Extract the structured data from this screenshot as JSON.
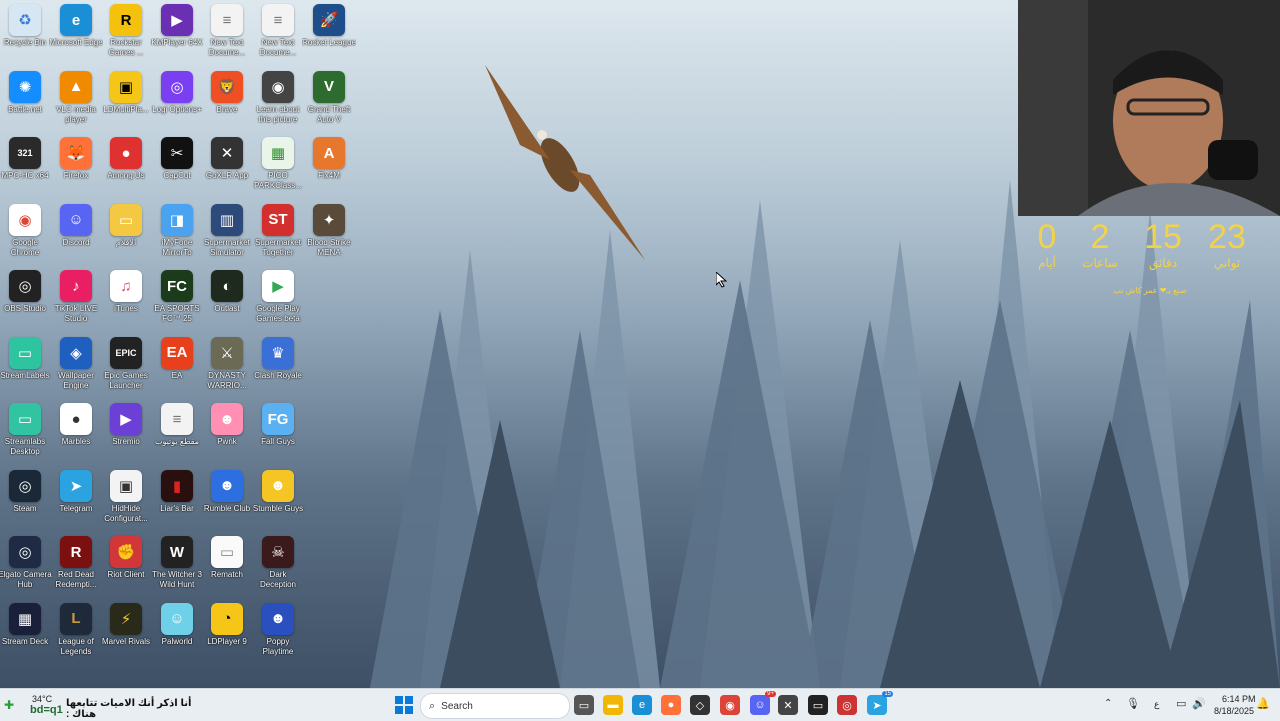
{
  "desktop_icons": [
    {
      "label": "Recycle Bin",
      "color": "#d7e6f3",
      "glyph": "♻",
      "glyph_color": "#3a7bd5"
    },
    {
      "label": "Microsoft Edge",
      "color": "#1b8fd6",
      "glyph": "e"
    },
    {
      "label": "Rockstar Games ...",
      "color": "#f4c20d",
      "glyph": "R",
      "glyph_color": "#000"
    },
    {
      "label": "KMPlayer 64X",
      "color": "#6b2fb3",
      "glyph": "▶"
    },
    {
      "label": "New Text Docume...",
      "color": "#f3f3f3",
      "glyph": "≡",
      "glyph_color": "#777"
    },
    {
      "label": "New Text Docume...",
      "color": "#f3f3f3",
      "glyph": "≡",
      "glyph_color": "#777"
    },
    {
      "label": "Rocket League",
      "color": "#1d4e89",
      "glyph": "🚀"
    },
    {
      "label": "Battle.net",
      "color": "#148eff",
      "glyph": "✺"
    },
    {
      "label": "VLC media player",
      "color": "#f08a00",
      "glyph": "▲"
    },
    {
      "label": "LDMultiPla...",
      "color": "#f5c518",
      "glyph": "▣",
      "glyph_color": "#000"
    },
    {
      "label": "Logi Options+",
      "color": "#7b3ff2",
      "glyph": "◎"
    },
    {
      "label": "Brave",
      "color": "#f04e23",
      "glyph": "🦁"
    },
    {
      "label": "Learn about this picture",
      "color": "#444",
      "glyph": "◉"
    },
    {
      "label": "Grand Theft Auto V",
      "color": "#2e6b2e",
      "glyph": "V"
    },
    {
      "label": "MPC-HC x64",
      "color": "#2a2a2a",
      "glyph": "321"
    },
    {
      "label": "Firefox",
      "color": "#ff7139",
      "glyph": "🦊"
    },
    {
      "label": "Among Us",
      "color": "#e03131",
      "glyph": "●"
    },
    {
      "label": "CapCut",
      "color": "#111",
      "glyph": "✂"
    },
    {
      "label": "GoXLR App",
      "color": "#333",
      "glyph": "✕"
    },
    {
      "label": "PICO PARKClass...",
      "color": "#e8f5e8",
      "glyph": "▦",
      "glyph_color": "#2f8f2f"
    },
    {
      "label": "Fix4M",
      "color": "#e8772e",
      "glyph": "A"
    },
    {
      "label": "Google Chrome",
      "color": "#fff",
      "glyph": "◉",
      "glyph_color": "#db4437"
    },
    {
      "label": "Discord",
      "color": "#5865f2",
      "glyph": "☺"
    },
    {
      "label": "الافلام",
      "color": "#f5c842",
      "glyph": "▭"
    },
    {
      "label": "iMyFone MirrorTo",
      "color": "#4aa3f0",
      "glyph": "◨"
    },
    {
      "label": "Supermarket Simulator",
      "color": "#2c4a7a",
      "glyph": "▥"
    },
    {
      "label": "Supermarket Together",
      "color": "#d32f2f",
      "glyph": "ST"
    },
    {
      "label": "Blood Strike MENA",
      "color": "#5a4a3a",
      "glyph": "✦"
    },
    {
      "label": "OBS Studio",
      "color": "#222",
      "glyph": "◎"
    },
    {
      "label": "TikTok LIVE Studio",
      "color": "#e91e63",
      "glyph": "♪"
    },
    {
      "label": "iTunes",
      "color": "#fff",
      "glyph": "♫",
      "glyph_color": "#e0457b"
    },
    {
      "label": "EA SPORTS FC™ 25",
      "color": "#1b3b1b",
      "glyph": "FC"
    },
    {
      "label": "Outlast",
      "color": "#1f2a1f",
      "glyph": "◐"
    },
    {
      "label": "Google Play Games beta",
      "color": "#fff",
      "glyph": "▶",
      "glyph_color": "#34a853"
    },
    {
      "label": "StreamLabels",
      "color": "#2ec4a0",
      "glyph": "▭"
    },
    {
      "label": "Wallpaper Engine",
      "color": "#1e5fbf",
      "glyph": "◈"
    },
    {
      "label": "Epic Games Launcher",
      "color": "#222",
      "glyph": "EPIC"
    },
    {
      "label": "EA",
      "color": "#e8401c",
      "glyph": "EA"
    },
    {
      "label": "DYNASTY WARRIO...",
      "color": "#6a6a55",
      "glyph": "⚔"
    },
    {
      "label": "Clash Royale",
      "color": "#3a6fd6",
      "glyph": "♛"
    },
    {
      "label": "Streamlabs Desktop",
      "color": "#31c3a2",
      "glyph": "▭"
    },
    {
      "label": "Marbles",
      "color": "#fff",
      "glyph": "●",
      "glyph_color": "#333"
    },
    {
      "label": "Stremio",
      "color": "#6c3fd6",
      "glyph": "▶"
    },
    {
      "label": "مقطع يوتيوب",
      "color": "#f3f3f3",
      "glyph": "≡",
      "glyph_color": "#777"
    },
    {
      "label": "Pwnk",
      "color": "#ff8fb3",
      "glyph": "☻"
    },
    {
      "label": "Fall Guys",
      "color": "#5ab0f0",
      "glyph": "FG"
    },
    {
      "label": "Steam",
      "color": "#1b2838",
      "glyph": "◎"
    },
    {
      "label": "Telegram",
      "color": "#2aa3e0",
      "glyph": "➤"
    },
    {
      "label": "HidHide Configurat...",
      "color": "#f3f3f3",
      "glyph": "▣",
      "glyph_color": "#333"
    },
    {
      "label": "Liar's Bar",
      "color": "#2a0f0f",
      "glyph": "▮",
      "glyph_color": "#d22"
    },
    {
      "label": "Rumble Club",
      "color": "#2d6fe0",
      "glyph": "☻"
    },
    {
      "label": "Stumble Guys",
      "color": "#f5c623",
      "glyph": "☻"
    },
    {
      "label": "Elgato Camera Hub",
      "color": "#1f2a44",
      "glyph": "◎"
    },
    {
      "label": "Red Dead Redempti...",
      "color": "#7a1010",
      "glyph": "R"
    },
    {
      "label": "Riot Client",
      "color": "#d13639",
      "glyph": "✊"
    },
    {
      "label": "The Witcher 3 Wild Hunt",
      "color": "#222",
      "glyph": "W"
    },
    {
      "label": "Rematch",
      "color": "#fafafa",
      "glyph": "▭",
      "glyph_color": "#888"
    },
    {
      "label": "Dark Deception",
      "color": "#3a1a1a",
      "glyph": "☠"
    },
    {
      "label": "Stream Deck",
      "color": "#1a1f3a",
      "glyph": "▦"
    },
    {
      "label": "League of Legends",
      "color": "#1e2a3a",
      "glyph": "L",
      "glyph_color": "#c89b3c"
    },
    {
      "label": "Marvel Rivals",
      "color": "#2a2a1a",
      "glyph": "⚡",
      "glyph_color": "#f5c842"
    },
    {
      "label": "Palworld",
      "color": "#6fd1e8",
      "glyph": "☺"
    },
    {
      "label": "LDPlayer 9",
      "color": "#f5c518",
      "glyph": "◔",
      "glyph_color": "#000"
    },
    {
      "label": "Poppy Playtime",
      "color": "#2a4fbf",
      "glyph": "☻"
    }
  ],
  "countdown": {
    "units": [
      {
        "value": "0",
        "label": "أيام"
      },
      {
        "value": "2",
        "label": "ساعات"
      },
      {
        "value": "15",
        "label": "دقائق"
      },
      {
        "value": "23",
        "label": "ثواني"
      }
    ],
    "credit": "صنع بـ❤ عمر كاش نب"
  },
  "taskbar": {
    "weather_temp": "34°C",
    "weather_name": "bd=q1",
    "ticker": "أنا اذكر أنك الاميات تتابعها هناك :",
    "search_placeholder": "Search",
    "language": "ع",
    "time": "6:14 PM",
    "date": "8/18/2025",
    "telegram_badge": "15",
    "discord_badge": "9+"
  }
}
